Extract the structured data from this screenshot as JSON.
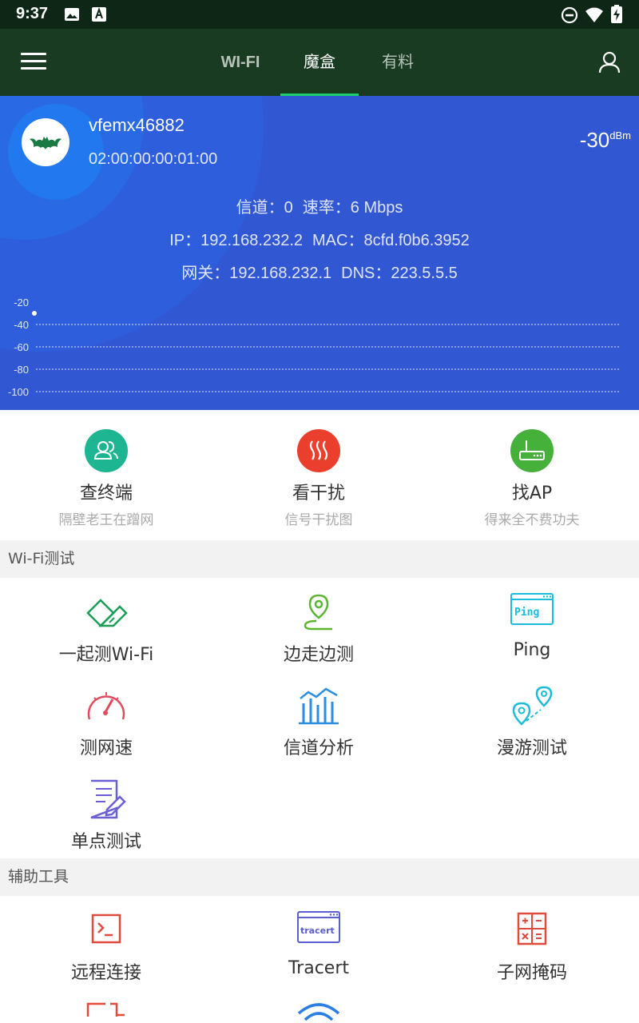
{
  "status_bar": {
    "time": "9:37"
  },
  "appbar": {
    "tabs": [
      "WI-FI",
      "魔盒",
      "有料"
    ],
    "active_tab": "魔盒"
  },
  "network": {
    "ssid": "vfemx46882",
    "bssid": "02:00:00:00:01:00",
    "signal_value": "-30",
    "signal_unit": "dBm",
    "channel_label": "信道：",
    "channel": "0",
    "rate_label": "速率：",
    "rate": "6 Mbps",
    "ip_label": "IP：",
    "ip": "192.168.232.2",
    "mac_label": "MAC：",
    "mac": "8cfd.f0b6.3952",
    "gateway_label": "网关：",
    "gateway": "192.168.232.1",
    "dns_label": "DNS：",
    "dns": "223.5.5.5"
  },
  "chart_data": {
    "type": "line",
    "y_ticks": [
      "-20",
      "-40",
      "-60",
      "-80",
      "-100"
    ],
    "ylim": [
      -100,
      -20
    ],
    "grid": true,
    "series": [
      {
        "values": [
          -30
        ]
      }
    ]
  },
  "quick_tools": [
    {
      "title": "查终端",
      "subtitle": "隔壁老王在蹭网",
      "color": "#1eb592"
    },
    {
      "title": "看干扰",
      "subtitle": "信号干扰图",
      "color": "#ea3f2c"
    },
    {
      "title": "找AP",
      "subtitle": "得来全不费功夫",
      "color": "#45b03a"
    }
  ],
  "wifi_test": {
    "header": "Wi-Fi测试",
    "items": [
      "一起测Wi-Fi",
      "边走边测",
      "Ping",
      "测网速",
      "信道分析",
      "漫游测试",
      "单点测试"
    ]
  },
  "tools": {
    "header": "辅助工具",
    "items": [
      "远程连接",
      "Tracert",
      "子网掩码"
    ]
  },
  "icon_text": {
    "ping": "Ping",
    "tracert": "tracert"
  },
  "colors": {
    "status_bar": "#0d2616",
    "app_bar": "#193b22",
    "tab_indicator": "#1ed06b",
    "hero_bg": "#3257d3"
  }
}
